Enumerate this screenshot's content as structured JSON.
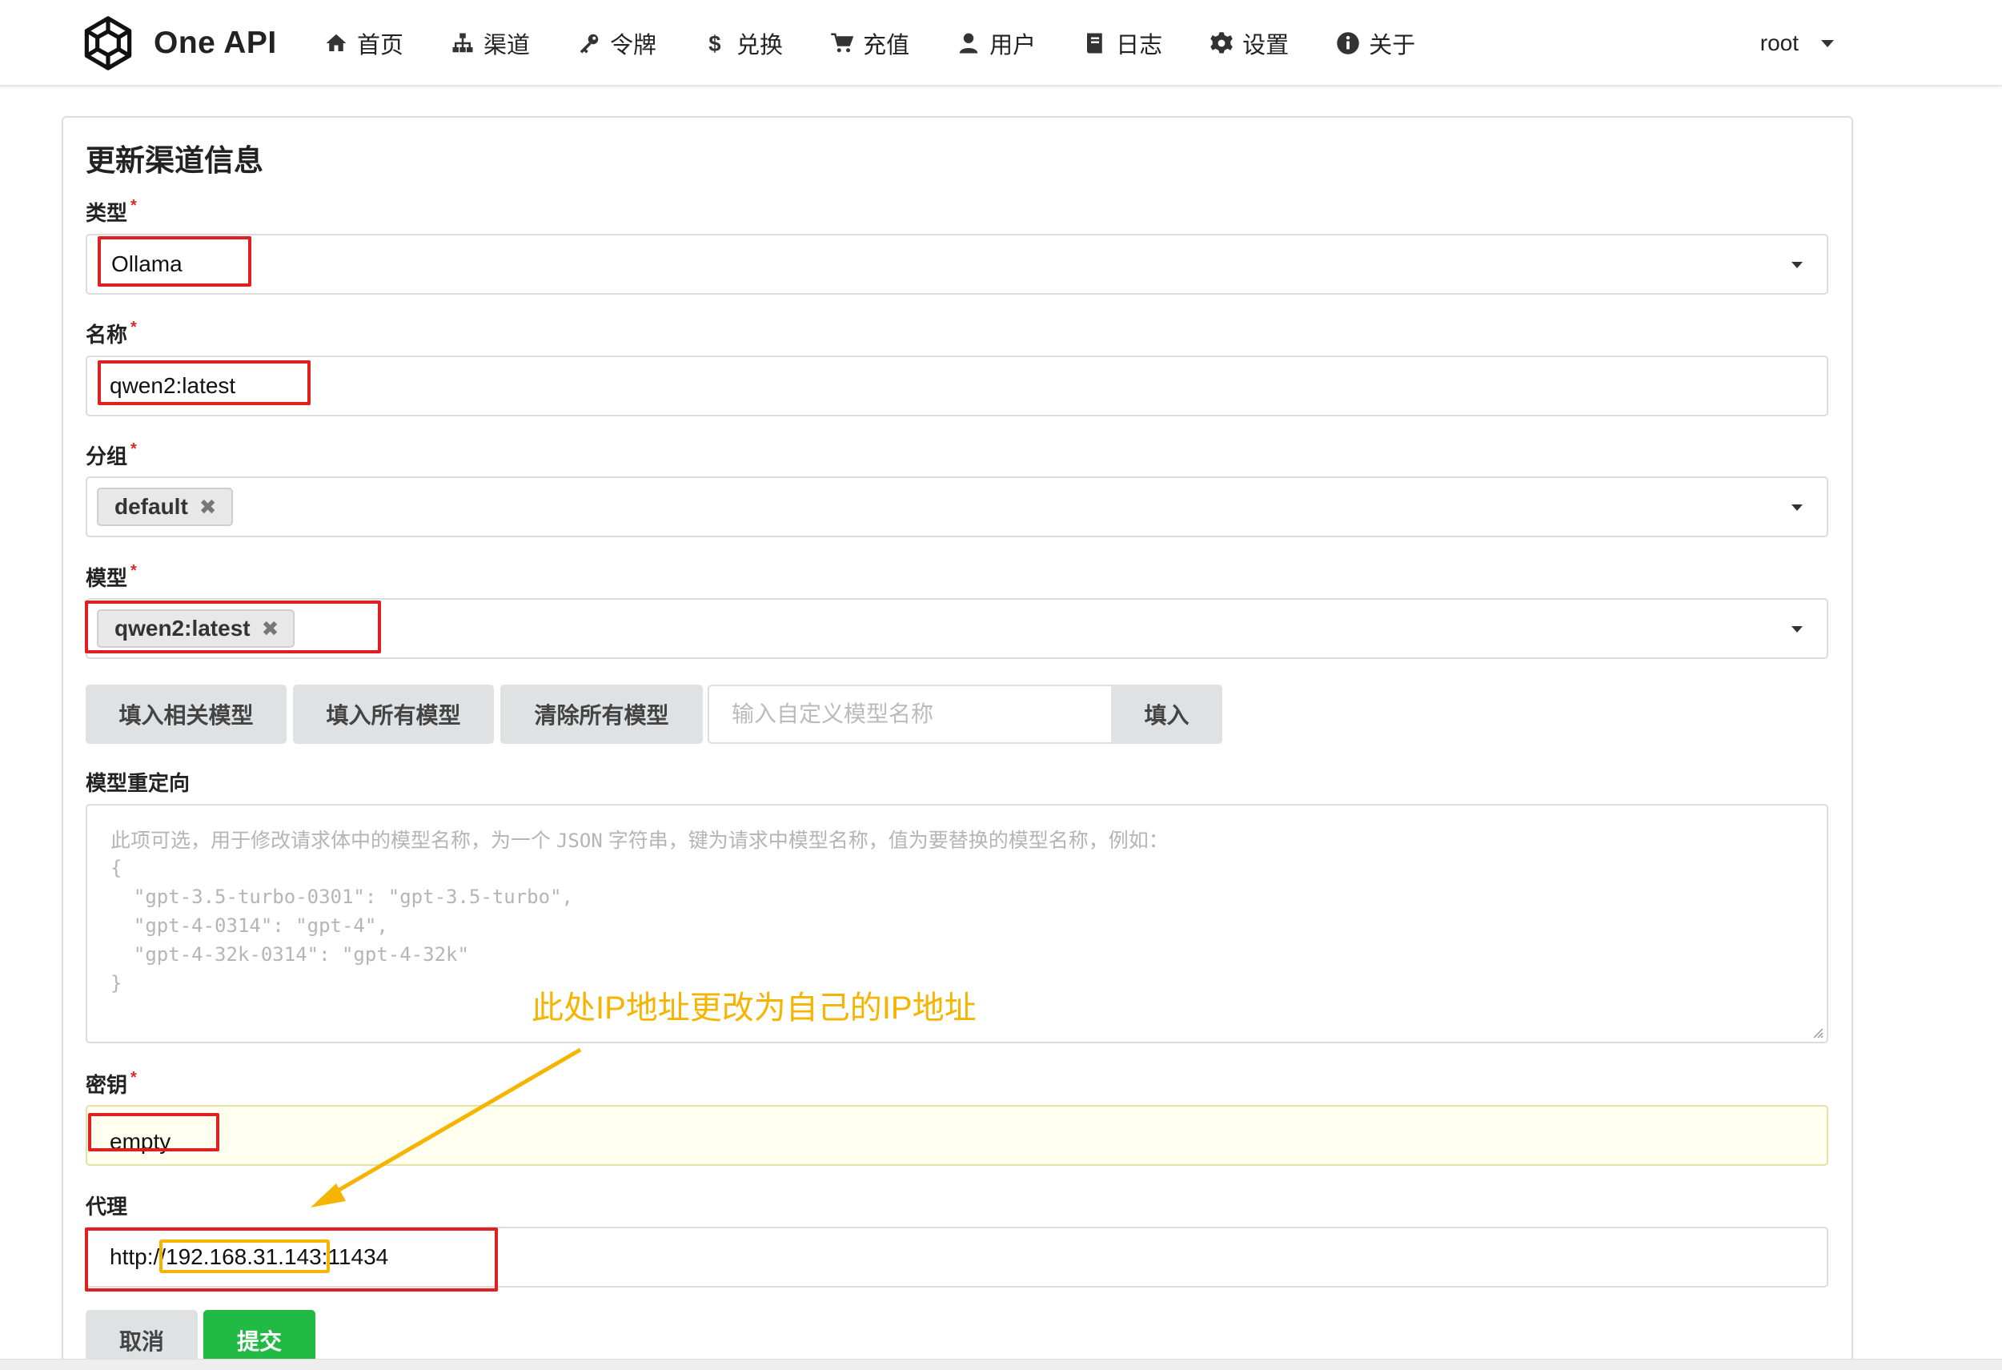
{
  "brand": {
    "name": "One API"
  },
  "nav": [
    {
      "label": "首页",
      "icon": "home-icon"
    },
    {
      "label": "渠道",
      "icon": "sitemap-icon"
    },
    {
      "label": "令牌",
      "icon": "key-icon"
    },
    {
      "label": "兑换",
      "icon": "dollar-icon"
    },
    {
      "label": "充值",
      "icon": "cart-icon"
    },
    {
      "label": "用户",
      "icon": "user-icon"
    },
    {
      "label": "日志",
      "icon": "book-icon"
    },
    {
      "label": "设置",
      "icon": "gear-icon"
    },
    {
      "label": "关于",
      "icon": "info-icon"
    }
  ],
  "user": {
    "name": "root"
  },
  "form": {
    "title": "更新渠道信息",
    "type": {
      "label": "类型",
      "value": "Ollama"
    },
    "name": {
      "label": "名称",
      "value": "qwen2:latest"
    },
    "group": {
      "label": "分组",
      "chip": "default"
    },
    "models": {
      "label": "模型",
      "chip": "qwen2:latest"
    },
    "model_buttons": {
      "fill_related": "填入相关模型",
      "fill_all": "填入所有模型",
      "clear_all": "清除所有模型",
      "custom_placeholder": "输入自定义模型名称",
      "fill": "填入"
    },
    "mapping": {
      "label": "模型重定向",
      "placeholder_intro_a": "此项可选，用于修改请求体中的模型名称，为一个",
      "placeholder_intro_json": "JSON",
      "placeholder_intro_b": "字符串，键为请求中模型名称，值为要替换的模型名称，例如：",
      "placeholder_lines": [
        "{",
        "  \"gpt-3.5-turbo-0301\": \"gpt-3.5-turbo\",",
        "  \"gpt-4-0314\": \"gpt-4\",",
        "  \"gpt-4-32k-0314\": \"gpt-4-32k\"",
        "}"
      ]
    },
    "key": {
      "label": "密钥",
      "value": "empty"
    },
    "proxy": {
      "label": "代理",
      "value": "http://192.168.31.143:11434"
    },
    "cancel": "取消",
    "submit": "提交"
  },
  "annotation": {
    "text": "此处IP地址更改为自己的IP地址"
  },
  "colors": {
    "primary_green": "#21ba45",
    "required_red": "#db2828",
    "annotation_red": "#e02020",
    "annotation_orange": "#f5b400"
  }
}
